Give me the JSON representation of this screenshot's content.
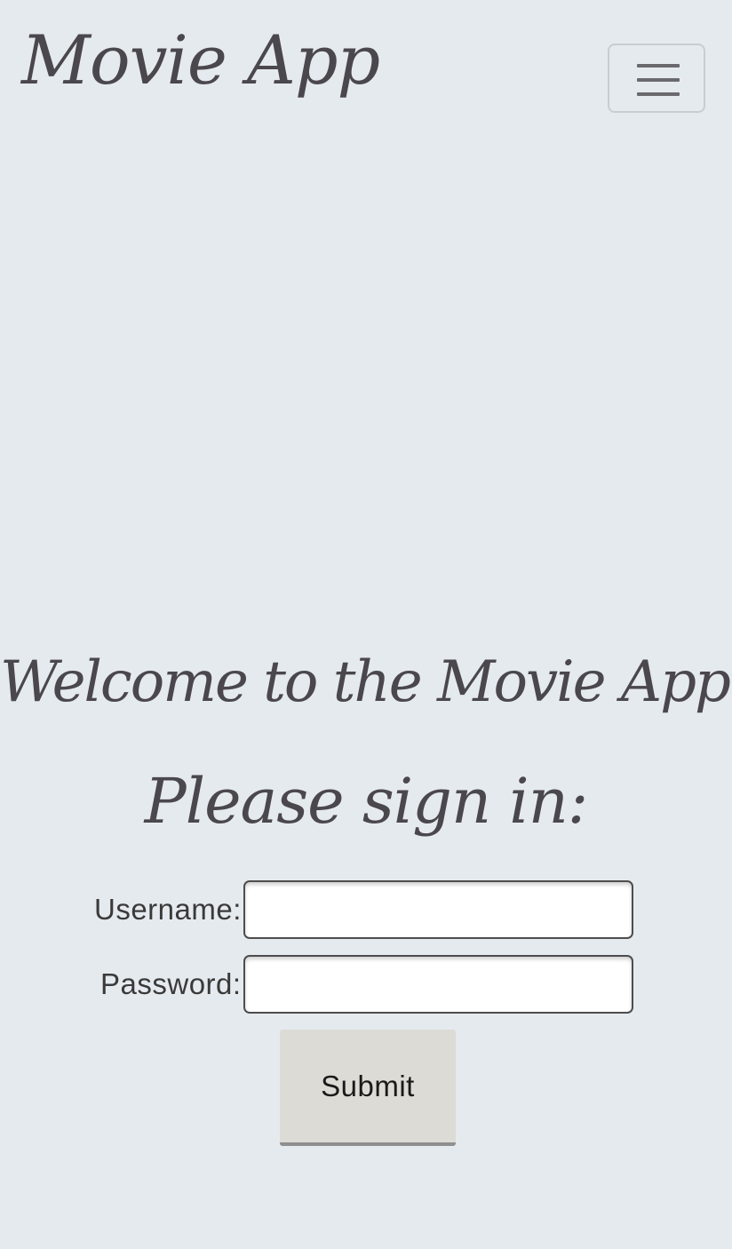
{
  "navbar": {
    "brand": "Movie App",
    "toggler_icon": "hamburger-menu-icon"
  },
  "main": {
    "welcome_heading": "Welcome to the Movie App!",
    "signin_heading": "Please sign in:"
  },
  "form": {
    "username_label": "Username:",
    "username_value": "",
    "password_label": "Password:",
    "password_value": "",
    "submit_label": "Submit"
  },
  "colors": {
    "background": "#e5eaee",
    "text": "#4a474d",
    "button": "#dcdbd5"
  }
}
